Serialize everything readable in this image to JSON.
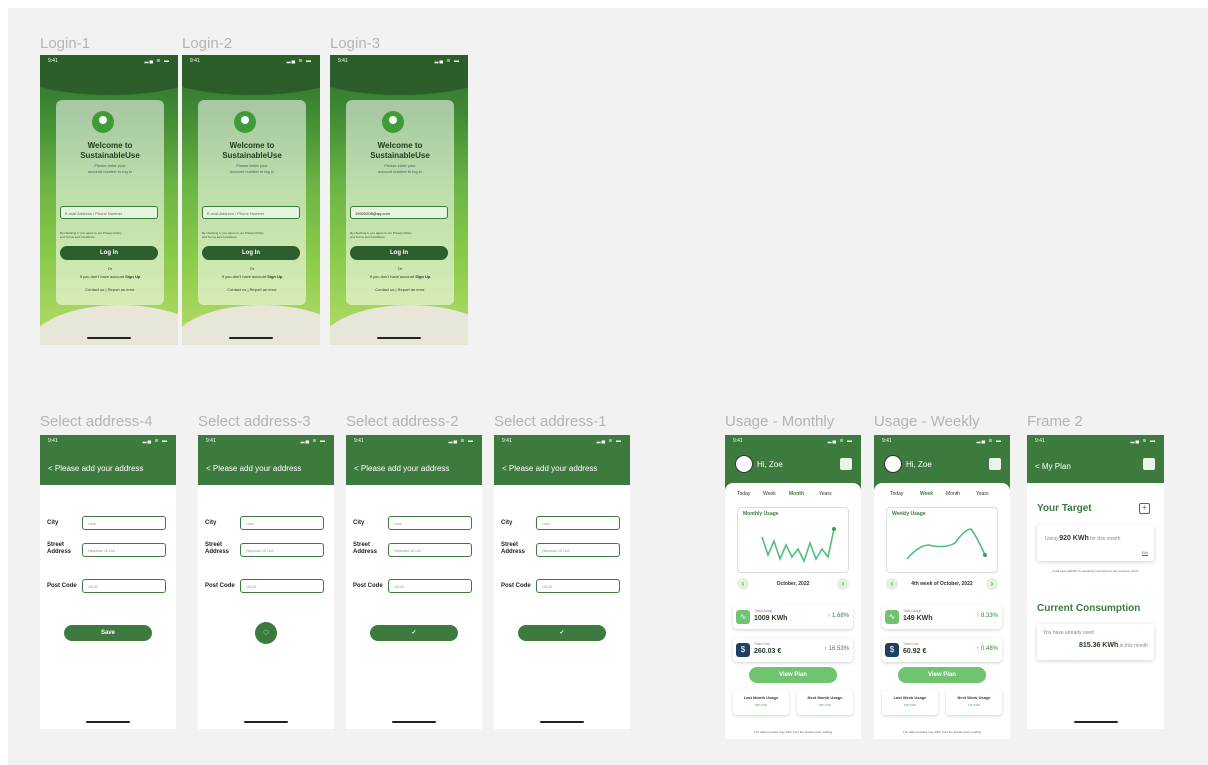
{
  "labels": {
    "login1": "Login-1",
    "login2": "Login-2",
    "login3": "Login-3",
    "addr4": "Select address-4",
    "addr3": "Select address-3",
    "addr2": "Select address-2",
    "addr1": "Select address-1",
    "usageMonthly": "Usage - Monthly",
    "usageWeekly": "Usage - Weekly",
    "frame2": "Frame 2"
  },
  "status": {
    "time": "9:41",
    "icons": "▂▄ ≋ ▬"
  },
  "login": {
    "title1": "Welcome to",
    "title2": "SustainableUse",
    "sub1": "Please enter your",
    "sub2": "account number to log in",
    "placeholder": "E-mail Address / Phone Number",
    "filled": "19920208@qq.com",
    "terms1": "By checking it, you agree to our Privacy Policy",
    "terms2": "and Terms and Conditions",
    "button": "Log In",
    "or": "Or",
    "noAccount": "If you don't have account",
    "signup": "Sign Up",
    "contact": "Contact us | Report an error"
  },
  "address": {
    "header": "< Please add your address",
    "cityLabel": "City",
    "streetLabel1": "Street",
    "streetLabel2": "Address",
    "postLabel": "Post Code",
    "city": "Lahti",
    "street": "Harjukatu 18 1A4",
    "post": "15140",
    "save": "Save",
    "spinner": "◌",
    "check": "✓"
  },
  "usage": {
    "greeting": "Hi, Zoe",
    "tabs": [
      "Today",
      "Week",
      "Month",
      "Years"
    ],
    "monthly": {
      "chartTitle": "Monthly Usage",
      "period": "October, 2022",
      "usageLabel": "Total Usage",
      "usage": "1009 KWh",
      "usagePct": "↑ 1.68%",
      "costLabel": "Total Cost",
      "cost": "260.03 €",
      "costPct": "↑ 16.53%",
      "button": "View Plan",
      "last": "Last Month Usage",
      "lastVal": "998 KWh",
      "next": "Next Month Usage",
      "nextVal": "980 KWh",
      "footer": "The data provided may differ from the actual meter reading"
    },
    "weekly": {
      "chartTitle": "Weekly Usage",
      "period": "4th week of October, 2022",
      "usageLabel": "Total Usage",
      "usage": "149 KWh",
      "usagePct": "↑ 8.33%",
      "costLabel": "Total Cost",
      "cost": "60.92 €",
      "costPct": "↑ 0.48%",
      "button": "View Plan",
      "last": "Last Week Usage",
      "lastVal": "138 KWh",
      "next": "Next Week Usage",
      "nextVal": "145 KWh",
      "footer": "The data provided may differ from the actual meter reading"
    },
    "arrowLeft": "‹",
    "arrowRight": "›"
  },
  "plan": {
    "header": "< My Plan",
    "target": "Your Target",
    "using": "Using",
    "targetVal": "920 KWh",
    "forMonth": "for this month",
    "edit": "Edit",
    "note": "It will save 19KWh on electricity compared to the previous month",
    "current": "Current Consumption",
    "already": "You have already used",
    "usedVal": "815.36 KWh",
    "inMonth": "in this month",
    "plus": "+"
  },
  "colors": {
    "primary": "#3d7a3d",
    "accent": "#6fc46f",
    "dark": "#2e5e2e"
  }
}
